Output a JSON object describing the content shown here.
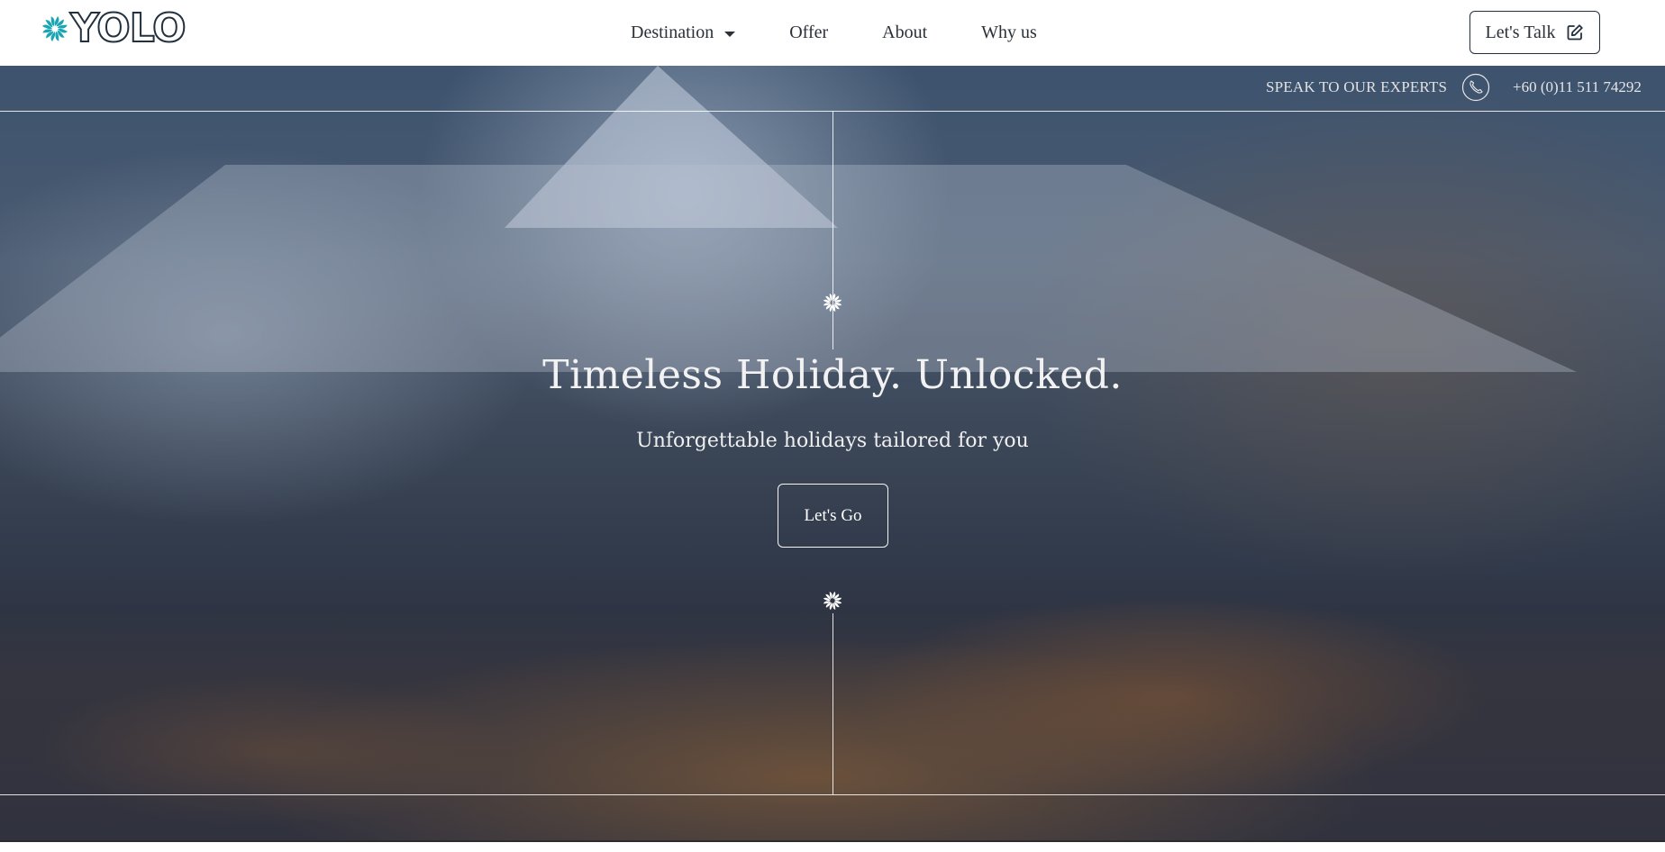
{
  "brand": {
    "name": "YOLO",
    "accent": "#18a5b4",
    "ink": "#22303f"
  },
  "nav": {
    "items": [
      {
        "label": "Destination",
        "has_dropdown": true
      },
      {
        "label": "Offer"
      },
      {
        "label": "About"
      },
      {
        "label": "Why us"
      }
    ],
    "cta_label": "Let's Talk",
    "cta_icon": "edit-icon"
  },
  "contact": {
    "speak_label": "SPEAK TO OUR EXPERTS",
    "phone_icon": "phone-icon",
    "phone_number": "+60 (0)11 511 74292"
  },
  "hero": {
    "title": "Timeless Holiday. Unlocked.",
    "subtitle": "Unforgettable holidays tailored for you",
    "button_label": "Let's Go",
    "decor_icon": "swirl-icon"
  }
}
